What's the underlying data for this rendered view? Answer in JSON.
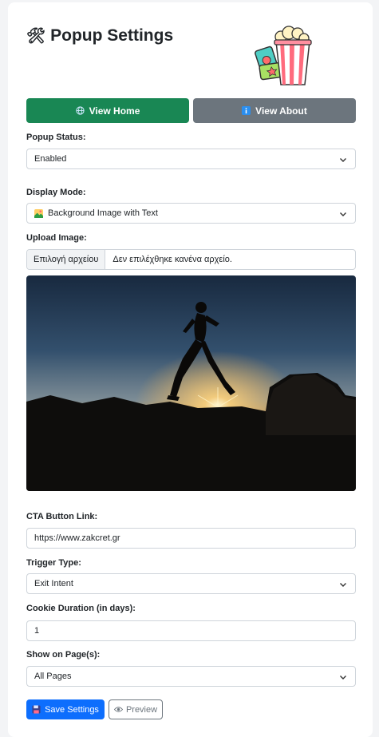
{
  "header": {
    "title": "Popup Settings",
    "tools_glyph": "🛠"
  },
  "nav": {
    "home_label": "View Home",
    "about_label": "View About"
  },
  "form": {
    "status_label": "Popup Status:",
    "status_value": "Enabled",
    "mode_label": "Display Mode:",
    "mode_value": "Background Image with Text",
    "upload_label": "Upload Image:",
    "file_button": "Επιλογή αρχείου",
    "file_text": "Δεν επιλέχθηκε κανένα αρχείο.",
    "cta_label": "CTA Button Link:",
    "cta_value": "https://www.zakcret.gr",
    "trigger_label": "Trigger Type:",
    "trigger_value": "Exit Intent",
    "cookie_label": "Cookie Duration (in days):",
    "cookie_value": "1",
    "pages_label": "Show on Page(s):",
    "pages_value": "All Pages"
  },
  "actions": {
    "save_label": "Save Settings",
    "preview_label": "Preview"
  },
  "icons": {
    "title": "tools-icon",
    "logo": "popcorn-icon",
    "home": "globe-icon",
    "about": "info-icon",
    "select": "chevron-down-icon",
    "mode": "image-icon",
    "save": "floppy-disk-icon",
    "preview": "eye-icon"
  },
  "colors": {
    "home": "#198754",
    "about": "#6c757d",
    "save": "#0d6efd",
    "text": "#212529",
    "border": "#ced4da"
  }
}
